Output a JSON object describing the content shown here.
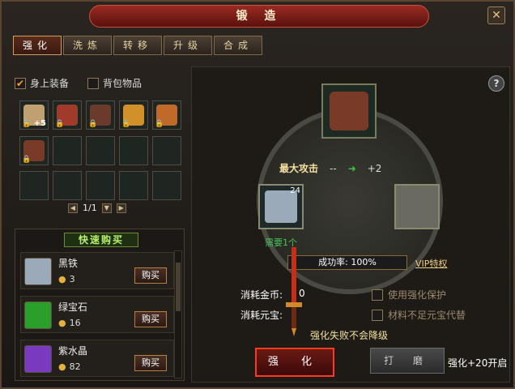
{
  "window": {
    "title": "锻 造",
    "close": "✕"
  },
  "tabs": [
    {
      "label": "强化",
      "active": true
    },
    {
      "label": "洗炼"
    },
    {
      "label": "转移"
    },
    {
      "label": "升级"
    },
    {
      "label": "合成"
    }
  ],
  "filters": {
    "equipped": {
      "label": "身上装备",
      "checked": true
    },
    "bag": {
      "label": "背包物品",
      "checked": false
    }
  },
  "inventory": {
    "page": "1/1",
    "slots": [
      {
        "name": "sword",
        "color": "#c0a070",
        "plus": "+5"
      },
      {
        "name": "armor-red",
        "color": "#a03a2a"
      },
      {
        "name": "helmet",
        "color": "#6a3a2a"
      },
      {
        "name": "bracer-gold",
        "color": "#d0902a"
      },
      {
        "name": "bracer-orange",
        "color": "#c06a2a"
      },
      {
        "name": "belt",
        "color": "#7a3a28"
      }
    ]
  },
  "shop": {
    "title": "快速购买",
    "buy_label": "购买",
    "items": [
      {
        "name": "黑铁",
        "price": "3",
        "color": "#9aaab8"
      },
      {
        "name": "绿宝石",
        "price": "16",
        "color": "#2aa02a"
      },
      {
        "name": "紫水晶",
        "price": "82",
        "color": "#7a3ac0"
      }
    ]
  },
  "forge": {
    "help": "?",
    "stat_label": "最大攻击",
    "stat_from": "--",
    "stat_to": "+2",
    "material_count": "24",
    "need_text": "需要1个",
    "success_text": "成功率: 100%",
    "vip_text": "VIP特权",
    "gold_label": "消耗金币:",
    "gold_value": "0",
    "yuanbao_label": "消耗元宝:",
    "opt_protect": "使用强化保护",
    "opt_substitute": "材料不足元宝代替",
    "warn": "强化失败不会降级",
    "btn_strengthen": "强 化",
    "btn_grind": "打 磨",
    "plus20": "强化+20开启"
  }
}
